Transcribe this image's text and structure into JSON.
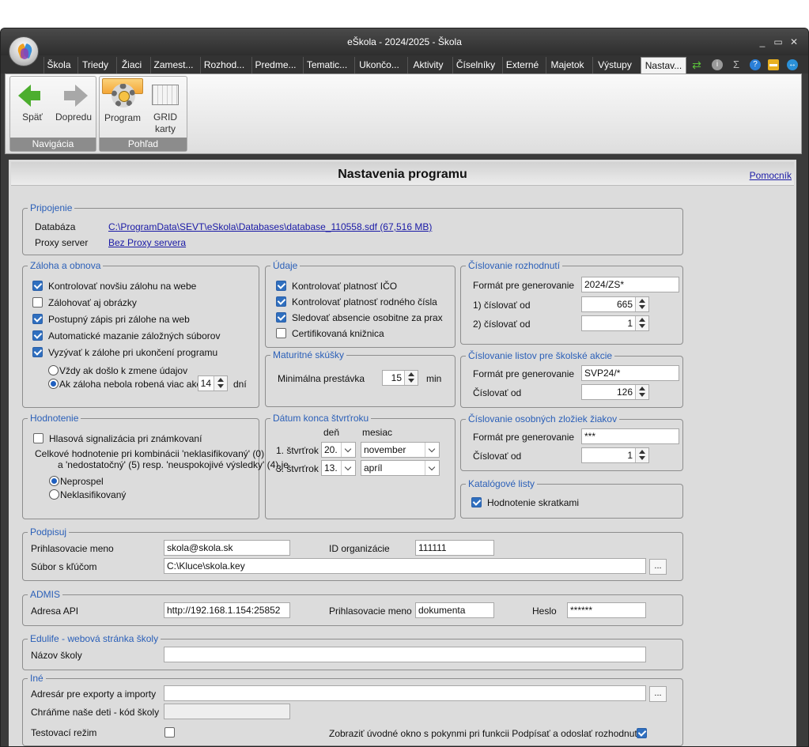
{
  "window": {
    "title": "eŠkola - 2024/2025 - Škola"
  },
  "menu_tabs": [
    "Škola",
    "Triedy",
    "Žiaci",
    "Zamest...",
    "Rozhod...",
    "Predme...",
    "Tematic...",
    "Ukončo...",
    "Aktivity",
    "Číselníky",
    "Externé",
    "Majetok",
    "Výstupy",
    "Nastav..."
  ],
  "ribbon": {
    "nav": {
      "label": "Navigácia",
      "back": "Späť",
      "forward": "Dopredu"
    },
    "view": {
      "label": "Pohľad",
      "program": "Program",
      "grid": "GRID karty"
    }
  },
  "header": {
    "title": "Nastavenia programu",
    "help": "Pomocník"
  },
  "connection": {
    "title": "Pripojenie",
    "db_label": "Databáza",
    "db_value": "C:\\ProgramData\\SEVT\\eSkola\\Databases\\database_110558.sdf   (67,516 MB)",
    "proxy_label": "Proxy server",
    "proxy_value": "Bez Proxy servera"
  },
  "backup": {
    "title": "Záloha a obnova",
    "items": [
      {
        "label": "Kontrolovať novšiu zálohu na webe",
        "checked": true
      },
      {
        "label": "Zálohovať aj obrázky",
        "checked": false
      },
      {
        "label": "Postupný zápis pri zálohe na web",
        "checked": true
      },
      {
        "label": "Automatické mazanie záložných súborov",
        "checked": true
      },
      {
        "label": "Vyzývať k zálohe pri ukončení programu",
        "checked": true
      }
    ],
    "radio1": "Vždy ak došlo k zmene údajov",
    "radio2": "Ak záloha nebola robená viac ako",
    "days_value": "14",
    "days_unit": "dní"
  },
  "data_box": {
    "title": "Údaje",
    "items": [
      {
        "label": "Kontrolovať platnosť IČO",
        "checked": true
      },
      {
        "label": "Kontrolovať platnosť rodného čísla",
        "checked": true
      },
      {
        "label": "Sledovať absencie osobitne za prax",
        "checked": true
      },
      {
        "label": "Certifikovaná knižnica",
        "checked": false
      }
    ]
  },
  "decisions": {
    "title": "Číslovanie rozhodnutí",
    "format_label": "Formát pre generovanie",
    "format_value": "2024/ZS*",
    "n1_label": "1) číslovať od",
    "n1_value": "665",
    "n2_label": "2) číslovať od",
    "n2_value": "1"
  },
  "exam": {
    "title": "Maturitné skúšky",
    "label": "Minimálna prestávka",
    "value": "15",
    "unit": "min"
  },
  "sheets": {
    "title": "Číslovanie listov pre školské akcie",
    "format_label": "Formát pre generovanie",
    "format_value": "SVP24/*",
    "num_label": "Číslovať od",
    "num_value": "126"
  },
  "grading": {
    "title": "Hodnotenie",
    "voice_label": "Hlasová signalizácia pri známkovaní",
    "text1": "Celkové hodnotenie pri kombinácii 'neklasifikovaný' (0)",
    "text2": "a 'nedostatočný' (5) resp. 'neuspokojivé výsledky' (4) je",
    "radio1": "Neprospel",
    "radio2": "Neklasifikovaný"
  },
  "quarter": {
    "title": "Dátum konca štvrťroku",
    "day_header": "deň",
    "month_header": "mesiac",
    "q1_label": "1. štvrťrok",
    "q1_day": "20.",
    "q1_month": "november",
    "q3_label": "3. štvrťrok",
    "q3_day": "13.",
    "q3_month": "apríl"
  },
  "folders": {
    "title": "Číslovanie osobných zložiek žiakov",
    "format_label": "Formát pre generovanie",
    "format_value": "***",
    "num_label": "Číslovať od",
    "num_value": "1"
  },
  "catalog": {
    "title": "Katalógové listy",
    "label": "Hodnotenie skratkami"
  },
  "signing": {
    "title": "Podpisuj",
    "login_label": "Prihlasovacie meno",
    "login_value": "skola@skola.sk",
    "org_label": "ID organizácie",
    "org_value": "111111",
    "key_label": "Súbor s kľúčom",
    "key_value": "C:\\Kluce\\skola.key",
    "browse": "..."
  },
  "admis": {
    "title": "ADMIS",
    "api_label": "Adresa API",
    "api_value": "http://192.168.1.154:25852",
    "login_label": "Prihlasovacie meno",
    "login_value": "dokumenta",
    "pass_label": "Heslo",
    "pass_value": "******"
  },
  "edulife": {
    "title": "Edulife - webová stránka školy",
    "name_label": "Názov školy",
    "name_value": ""
  },
  "other": {
    "title": "Iné",
    "dir_label": "Adresár pre exporty a importy",
    "dir_value": "",
    "browse": "...",
    "code_label": "Chráňme naše deti - kód školy",
    "code_value": "",
    "test_label": "Testovací režim",
    "sign_label": "Zobraziť úvodné okno s pokynmi pri funkcii Podpísať a odoslať rozhodnutia"
  },
  "colors": {
    "accent": "#2f6fbf",
    "group_title": "#2a5fb8",
    "ribbon_selected": "#f4a637"
  }
}
